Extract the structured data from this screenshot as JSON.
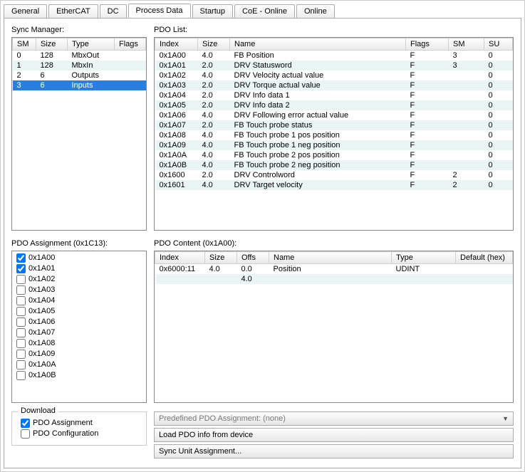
{
  "tabs": [
    "General",
    "EtherCAT",
    "DC",
    "Process Data",
    "Startup",
    "CoE - Online",
    "Online"
  ],
  "active_tab": 3,
  "labels": {
    "sync_manager": "Sync Manager:",
    "pdo_list": "PDO List:",
    "pdo_assignment": "PDO Assignment (0x1C13):",
    "pdo_content": "PDO Content (0x1A00):",
    "download": "Download",
    "pdo_asg_chk": "PDO Assignment",
    "pdo_cfg_chk": "PDO Configuration",
    "predefined": "Predefined PDO Assignment: (none)",
    "load_btn": "Load PDO info from device",
    "sync_btn": "Sync Unit Assignment..."
  },
  "sync_mgr": {
    "cols": [
      "SM",
      "Size",
      "Type",
      "Flags"
    ],
    "rows": [
      {
        "sm": "0",
        "size": "128",
        "type": "MbxOut",
        "flags": "",
        "sel": false,
        "even": false
      },
      {
        "sm": "1",
        "size": "128",
        "type": "MbxIn",
        "flags": "",
        "sel": false,
        "even": true
      },
      {
        "sm": "2",
        "size": "6",
        "type": "Outputs",
        "flags": "",
        "sel": false,
        "even": false
      },
      {
        "sm": "3",
        "size": "6",
        "type": "Inputs",
        "flags": "",
        "sel": true,
        "even": false
      }
    ]
  },
  "pdo_list": {
    "cols": [
      "Index",
      "Size",
      "Name",
      "Flags",
      "SM",
      "SU"
    ],
    "rows": [
      {
        "index": "0x1A00",
        "size": "4.0",
        "name": "FB Position",
        "flags": "F",
        "sm": "3",
        "su": "0",
        "even": false
      },
      {
        "index": "0x1A01",
        "size": "2.0",
        "name": "DRV Statusword",
        "flags": "F",
        "sm": "3",
        "su": "0",
        "even": true
      },
      {
        "index": "0x1A02",
        "size": "4.0",
        "name": "DRV Velocity actual value",
        "flags": "F",
        "sm": "",
        "su": "0",
        "even": false
      },
      {
        "index": "0x1A03",
        "size": "2.0",
        "name": "DRV Torque actual value",
        "flags": "F",
        "sm": "",
        "su": "0",
        "even": true
      },
      {
        "index": "0x1A04",
        "size": "2.0",
        "name": "DRV Info data 1",
        "flags": "F",
        "sm": "",
        "su": "0",
        "even": false
      },
      {
        "index": "0x1A05",
        "size": "2.0",
        "name": "DRV Info data 2",
        "flags": "F",
        "sm": "",
        "su": "0",
        "even": true
      },
      {
        "index": "0x1A06",
        "size": "4.0",
        "name": "DRV Following error actual value",
        "flags": "F",
        "sm": "",
        "su": "0",
        "even": false
      },
      {
        "index": "0x1A07",
        "size": "2.0",
        "name": "FB Touch probe status",
        "flags": "F",
        "sm": "",
        "su": "0",
        "even": true
      },
      {
        "index": "0x1A08",
        "size": "4.0",
        "name": "FB Touch probe 1 pos position",
        "flags": "F",
        "sm": "",
        "su": "0",
        "even": false
      },
      {
        "index": "0x1A09",
        "size": "4.0",
        "name": "FB Touch probe 1 neg position",
        "flags": "F",
        "sm": "",
        "su": "0",
        "even": true
      },
      {
        "index": "0x1A0A",
        "size": "4.0",
        "name": "FB Touch probe 2 pos position",
        "flags": "F",
        "sm": "",
        "su": "0",
        "even": false
      },
      {
        "index": "0x1A0B",
        "size": "4.0",
        "name": "FB Touch probe 2 neg position",
        "flags": "F",
        "sm": "",
        "su": "0",
        "even": true
      },
      {
        "index": "0x1600",
        "size": "2.0",
        "name": "DRV Controlword",
        "flags": "F",
        "sm": "2",
        "su": "0",
        "even": false
      },
      {
        "index": "0x1601",
        "size": "4.0",
        "name": "DRV Target velocity",
        "flags": "F",
        "sm": "2",
        "su": "0",
        "even": true
      }
    ]
  },
  "pdo_assignment_list": [
    {
      "id": "0x1A00",
      "checked": true
    },
    {
      "id": "0x1A01",
      "checked": true
    },
    {
      "id": "0x1A02",
      "checked": false
    },
    {
      "id": "0x1A03",
      "checked": false
    },
    {
      "id": "0x1A04",
      "checked": false
    },
    {
      "id": "0x1A05",
      "checked": false
    },
    {
      "id": "0x1A06",
      "checked": false
    },
    {
      "id": "0x1A07",
      "checked": false
    },
    {
      "id": "0x1A08",
      "checked": false
    },
    {
      "id": "0x1A09",
      "checked": false
    },
    {
      "id": "0x1A0A",
      "checked": false
    },
    {
      "id": "0x1A0B",
      "checked": false
    }
  ],
  "pdo_content": {
    "cols": [
      "Index",
      "Size",
      "Offs",
      "Name",
      "Type",
      "Default (hex)"
    ],
    "rows": [
      {
        "index": "0x6000:11",
        "size": "4.0",
        "offs": "0.0",
        "name": "Position",
        "type": "UDINT",
        "def": "",
        "even": false
      },
      {
        "index": "",
        "size": "",
        "offs": "4.0",
        "name": "",
        "type": "",
        "def": "",
        "even": true
      }
    ]
  },
  "download": {
    "asg_checked": true,
    "cfg_checked": false
  }
}
